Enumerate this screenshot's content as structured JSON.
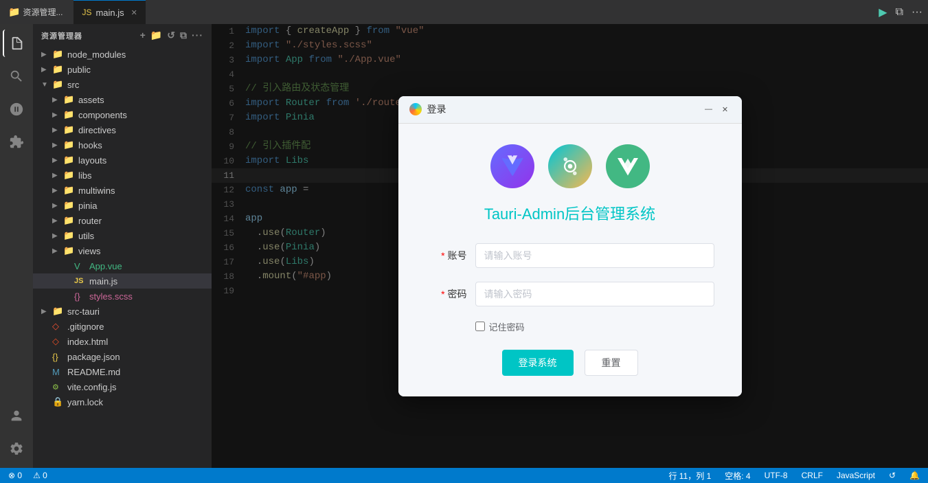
{
  "titlebar": {
    "explorer_label": "资源管理...",
    "tab_name": "main.js",
    "tab_icon": "JS"
  },
  "sidebar": {
    "title": "资源管理器",
    "folders": [
      {
        "name": "node_modules",
        "type": "folder",
        "collapsed": true,
        "depth": 0
      },
      {
        "name": "public",
        "type": "folder",
        "collapsed": true,
        "depth": 0
      },
      {
        "name": "src",
        "type": "folder",
        "collapsed": false,
        "depth": 0
      },
      {
        "name": "assets",
        "type": "folder",
        "collapsed": true,
        "depth": 1
      },
      {
        "name": "components",
        "type": "folder",
        "collapsed": true,
        "depth": 1
      },
      {
        "name": "directives",
        "type": "folder",
        "collapsed": true,
        "depth": 1
      },
      {
        "name": "hooks",
        "type": "folder",
        "collapsed": true,
        "depth": 1
      },
      {
        "name": "layouts",
        "type": "folder",
        "collapsed": true,
        "depth": 1
      },
      {
        "name": "libs",
        "type": "folder",
        "collapsed": true,
        "depth": 1
      },
      {
        "name": "multiwins",
        "type": "folder",
        "collapsed": true,
        "depth": 1
      },
      {
        "name": "pinia",
        "type": "folder",
        "collapsed": true,
        "depth": 1
      },
      {
        "name": "router",
        "type": "folder",
        "collapsed": true,
        "depth": 1
      },
      {
        "name": "utils",
        "type": "folder",
        "collapsed": true,
        "depth": 1
      },
      {
        "name": "views",
        "type": "folder",
        "collapsed": true,
        "depth": 1
      },
      {
        "name": "App.vue",
        "type": "vue",
        "depth": 1
      },
      {
        "name": "main.js",
        "type": "js",
        "depth": 1,
        "active": true
      },
      {
        "name": "styles.scss",
        "type": "scss",
        "depth": 1
      },
      {
        "name": "src-tauri",
        "type": "folder",
        "collapsed": true,
        "depth": 0
      },
      {
        "name": ".gitignore",
        "type": "git",
        "depth": 0
      },
      {
        "name": "index.html",
        "type": "html",
        "depth": 0
      },
      {
        "name": "package.json",
        "type": "json",
        "depth": 0
      },
      {
        "name": "README.md",
        "type": "md",
        "depth": 0
      },
      {
        "name": "vite.config.js",
        "type": "config",
        "depth": 0
      },
      {
        "name": "yarn.lock",
        "type": "lock",
        "depth": 0
      }
    ]
  },
  "editor": {
    "lines": [
      {
        "num": 1,
        "code": "import { createApp } from \"vue\""
      },
      {
        "num": 2,
        "code": "import \"./styles.scss\""
      },
      {
        "num": 3,
        "code": "import App from \"./App.vue\""
      },
      {
        "num": 4,
        "code": ""
      },
      {
        "num": 5,
        "code": "// 引入路由及状态管理"
      },
      {
        "num": 6,
        "code": "import Router from './router'"
      },
      {
        "num": 7,
        "code": "import Pinia"
      },
      {
        "num": 8,
        "code": ""
      },
      {
        "num": 9,
        "code": "// 引入插件配"
      },
      {
        "num": 10,
        "code": "import Libs"
      },
      {
        "num": 11,
        "code": ""
      },
      {
        "num": 12,
        "code": "const app ="
      },
      {
        "num": 13,
        "code": ""
      },
      {
        "num": 14,
        "code": "app"
      },
      {
        "num": 15,
        "code": "  .use(Router)"
      },
      {
        "num": 16,
        "code": "  .use(Pinia)"
      },
      {
        "num": 17,
        "code": "  .use(Libs)"
      },
      {
        "num": 18,
        "code": "  .mount(\"#app)"
      },
      {
        "num": 19,
        "code": ""
      }
    ]
  },
  "modal": {
    "title": "登录",
    "app_title": "Tauri-Admin后台管理系统",
    "account_label": "账号",
    "account_placeholder": "请输入账号",
    "password_label": "密码",
    "password_placeholder": "请输入密码",
    "remember_label": "记住密码",
    "login_button": "登录系统",
    "reset_button": "重置"
  },
  "status_bar": {
    "errors": "⊗ 0",
    "warnings": "⚠ 0",
    "row_col": "行 11，列 1",
    "spaces": "空格: 4",
    "encoding": "UTF-8",
    "line_ending": "CRLF",
    "language": "JavaScript",
    "sync_icon": "⟳",
    "bell_icon": "🔔"
  }
}
